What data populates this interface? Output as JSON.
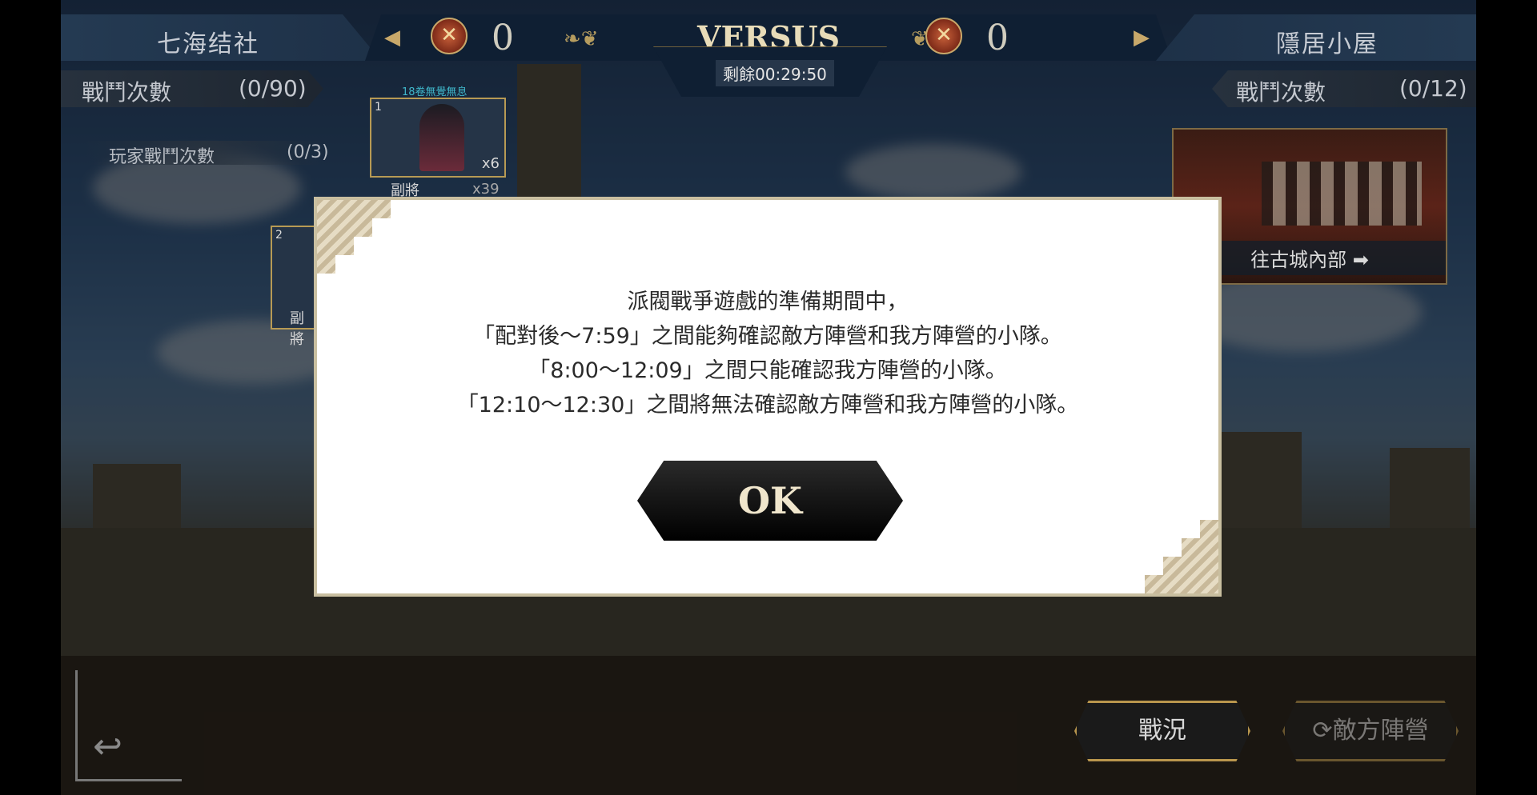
{
  "top_bar": {
    "left_team": "七海结社",
    "right_team": "隱居小屋",
    "left_score": "0",
    "right_score": "0",
    "versus": "VERSUS",
    "timer": "剩餘00:29:50"
  },
  "left_panel": {
    "battle_count_label": "戰鬥次數",
    "battle_count_value": "(0/90)",
    "player_battle_label": "玩家戰鬥次數",
    "player_battle_value": "(0/3)",
    "unit1": {
      "num": "1",
      "banner": "18卷無覺無息",
      "count": "x6",
      "role": "副將",
      "role_count": "x39"
    },
    "unit2": {
      "num": "2",
      "role": "副將"
    }
  },
  "right_panel": {
    "battle_count_label": "戰鬥次數",
    "battle_count_value": "(0/12)",
    "castle_button": "往古城內部 ➡"
  },
  "bottom": {
    "battle_status_button": "戰況",
    "enemy_camp_button": "敵方陣營"
  },
  "modal": {
    "line1": "派閥戰爭遊戲的準備期間中，",
    "line2": "「配對後～7:59」之間能夠確認敵方陣營和我方陣營的小隊。",
    "line3": "「8:00～12:09」之間只能確認我方陣營的小隊。",
    "line4": "「12:10～12:30」之間將無法確認敵方陣營和我方陣營的小隊。",
    "ok_label": "OK"
  }
}
